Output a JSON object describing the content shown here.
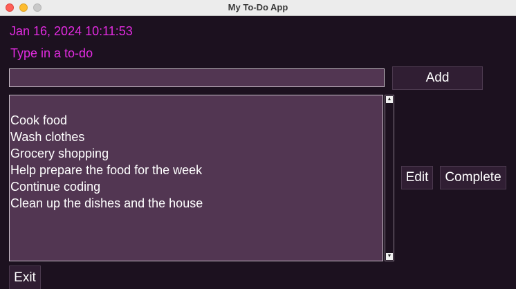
{
  "window": {
    "title": "My To-Do App"
  },
  "clock": {
    "text": "Jan 16, 2024 10:11:53"
  },
  "prompt": {
    "label": "Type in a to-do"
  },
  "input": {
    "value": ""
  },
  "buttons": {
    "add": "Add",
    "edit": "Edit",
    "complete": "Complete",
    "exit": "Exit"
  },
  "todos": [
    "Cook food",
    "Wash clothes",
    "Grocery shopping",
    "Help prepare the food for the week",
    "Continue coding",
    "Clean up the dishes and the house"
  ],
  "scrollbar": {
    "up_icon": "▲",
    "down_icon": "▼"
  },
  "colors": {
    "background": "#1c111f",
    "accent_text": "#e22be0",
    "field_bg": "#523652",
    "button_bg": "#301e33"
  }
}
